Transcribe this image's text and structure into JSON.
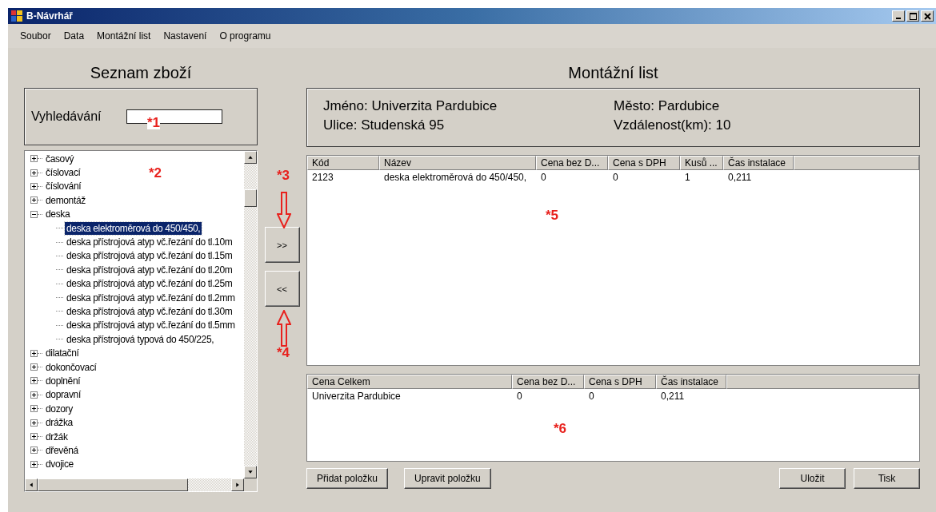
{
  "window": {
    "title": "B-Návrhář"
  },
  "menu": [
    "Soubor",
    "Data",
    "Montážní list",
    "Nastavení",
    "O programu"
  ],
  "left": {
    "heading": "Seznam zboží",
    "search": {
      "label": "Vyhledávání"
    },
    "tree": [
      {
        "label": "časový",
        "expanded": false,
        "selected": false
      },
      {
        "label": "číslovací",
        "expanded": false,
        "selected": false
      },
      {
        "label": "číslování",
        "expanded": false,
        "selected": false
      },
      {
        "label": "demontáž",
        "expanded": false,
        "selected": false
      },
      {
        "label": "deska",
        "expanded": true,
        "selected": false,
        "children": [
          {
            "label": "deska elektroměrová do 450/450,",
            "selected": true
          },
          {
            "label": "deska přístrojová atyp vč.řezání do tl.10m",
            "selected": false
          },
          {
            "label": "deska přístrojová atyp vč.řezání do tl.15m",
            "selected": false
          },
          {
            "label": "deska přístrojová atyp vč.řezání do tl.20m",
            "selected": false
          },
          {
            "label": "deska přístrojová atyp vč.řezání do tl.25m",
            "selected": false
          },
          {
            "label": "deska přístrojová atyp vč.řezání do tl.2mm",
            "selected": false
          },
          {
            "label": "deska přístrojová atyp vč.řezání do tl.30m",
            "selected": false
          },
          {
            "label": "deska přístrojová atyp vč.řezání do tl.5mm",
            "selected": false
          },
          {
            "label": "deska přístrojová typová do 450/225,",
            "selected": false
          }
        ]
      },
      {
        "label": "dilatační",
        "expanded": false,
        "selected": false
      },
      {
        "label": "dokončovací",
        "expanded": false,
        "selected": false
      },
      {
        "label": "doplnění",
        "expanded": false,
        "selected": false
      },
      {
        "label": "dopravní",
        "expanded": false,
        "selected": false
      },
      {
        "label": "dozory",
        "expanded": false,
        "selected": false
      },
      {
        "label": "drážka",
        "expanded": false,
        "selected": false
      },
      {
        "label": "držák",
        "expanded": false,
        "selected": false
      },
      {
        "label": "dřevěná",
        "expanded": false,
        "selected": false
      },
      {
        "label": "dvojice",
        "expanded": false,
        "selected": false
      }
    ]
  },
  "move_buttons": [
    ">>",
    "<<"
  ],
  "right": {
    "heading": "Montážní list",
    "info": [
      [
        "Jméno: Univerzita Pardubice",
        "Město: Pardubice"
      ],
      [
        "Ulice: Studenská 95",
        "Vzdálenost(km): 10"
      ]
    ],
    "items_table": {
      "columns": [
        "Kód",
        "Název",
        "Cena bez D...",
        "Cena s DPH",
        "Kusů ...",
        "Čas instalace"
      ],
      "rows": [
        [
          "2123",
          "deska elektroměrová do 450/450,",
          "0",
          "0",
          "1",
          "0,211"
        ]
      ]
    },
    "totals_table": {
      "columns": [
        "Cena Celkem",
        "Cena bez D...",
        "Cena s DPH",
        "Čas instalace"
      ],
      "rows": [
        [
          "Univerzita Pardubice",
          "0",
          "0",
          "0,211"
        ]
      ]
    },
    "buttons_left": [
      "Přidat položku",
      "Upravit položku"
    ],
    "buttons_right": [
      "Uložit",
      "Tisk"
    ]
  },
  "annotations": [
    "*1",
    "*2",
    "*3",
    "*4",
    "*5",
    "*6"
  ]
}
